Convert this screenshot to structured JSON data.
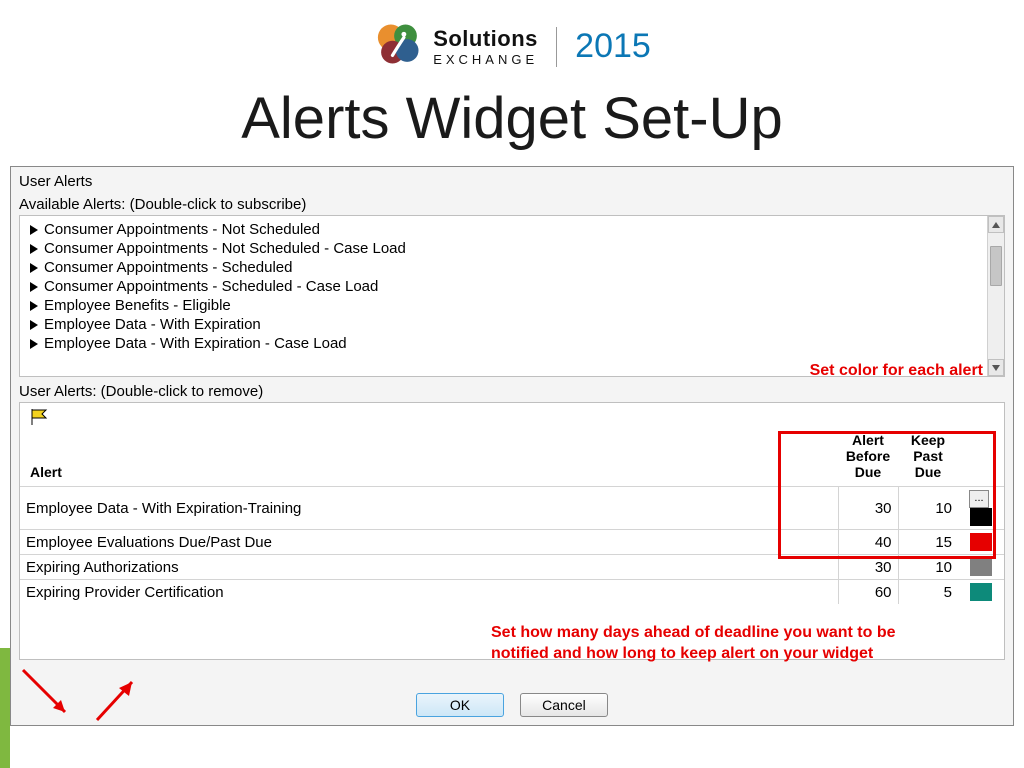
{
  "header": {
    "brand_top": "Solutions",
    "brand_bottom": "Exchange",
    "year": "2015",
    "title": "Alerts Widget Set-Up"
  },
  "dialog": {
    "title": "User Alerts",
    "available_label": "Available Alerts: (Double-click to subscribe)",
    "user_label": "User Alerts: (Double-click to remove)",
    "available_items": [
      "Consumer Appointments - Not Scheduled",
      "Consumer Appointments - Not Scheduled - Case Load",
      "Consumer Appointments - Scheduled",
      "Consumer Appointments - Scheduled - Case Load",
      "Employee Benefits - Eligible",
      "Employee Data - With Expiration",
      "Employee Data - With Expiration - Case Load"
    ],
    "columns": {
      "alert": "Alert",
      "before": "Alert\nBefore\nDue",
      "past": "Keep\nPast\nDue"
    },
    "user_alerts": [
      {
        "name": "Employee Data - With Expiration-Training",
        "before": 30,
        "past": 10,
        "color": "#000000",
        "more": true
      },
      {
        "name": "Employee Evaluations Due/Past Due",
        "before": 40,
        "past": 15,
        "color": "#e60000"
      },
      {
        "name": "Expiring Authorizations",
        "before": 30,
        "past": 10,
        "color": "#808080"
      },
      {
        "name": "Expiring Provider Certification",
        "before": 60,
        "past": 5,
        "color": "#0d8a7a"
      }
    ],
    "buttons": {
      "ok": "OK",
      "cancel": "Cancel"
    }
  },
  "annotations": {
    "color_hint": "Set color for each alert",
    "days_hint": "Set how many days ahead of deadline you want to be notified and how long to keep alert on your widget"
  }
}
